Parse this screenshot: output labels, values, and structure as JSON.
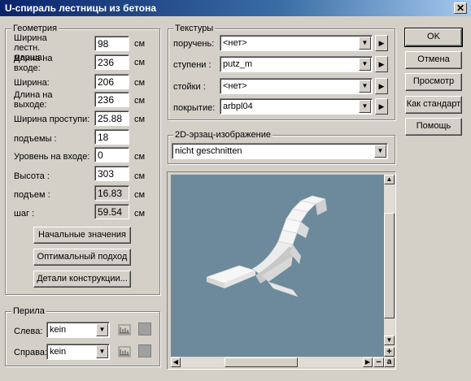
{
  "window": {
    "title": "U-спираль лестницы из бетона",
    "close": "✕"
  },
  "geometry": {
    "legend": "Геометрия",
    "fields": [
      {
        "label": "Ширина лестн. марша:",
        "value": "98",
        "unit": "см"
      },
      {
        "label": "Длина на входе:",
        "value": "236",
        "unit": "см"
      },
      {
        "label": "Ширина:",
        "value": "206",
        "unit": "см"
      },
      {
        "label": "Длина на выходе:",
        "value": "236",
        "unit": "см"
      },
      {
        "label": "Ширина проступи:",
        "value": "25.88",
        "unit": "см"
      },
      {
        "label": "подъемы :",
        "value": "18"
      },
      {
        "label": "Уровень на входе:",
        "value": "0",
        "unit": "см"
      },
      {
        "label": "Высота :",
        "value": "303",
        "unit": "см"
      },
      {
        "label": "подъем :",
        "value": "16.83",
        "unit": "см"
      },
      {
        "label": "шаг :",
        "value": "59.54",
        "unit": "см"
      }
    ],
    "buttons": {
      "initial": "Начальные значения",
      "optimal": "Оптимальный подход",
      "details": "Детали конструкции..."
    }
  },
  "railing": {
    "legend": "Перила",
    "left": {
      "label": "Слева:",
      "value": "kein"
    },
    "right": {
      "label": "Справа:",
      "value": "kein"
    }
  },
  "textures": {
    "legend": "Текстуры",
    "rows": [
      {
        "label": "поручень:",
        "value": "<нет>"
      },
      {
        "label": "ступени :",
        "value": "putz_m"
      },
      {
        "label": "стойки :",
        "value": "<нет>"
      },
      {
        "label": "покрытие:",
        "value": "arbpl04"
      }
    ]
  },
  "image2d": {
    "legend": "2D-эрзац-изображение",
    "value": "nicht geschnitten"
  },
  "actions": {
    "ok": "OK",
    "cancel": "Отмена",
    "preview": "Просмотр",
    "standard": "Как стандарт",
    "help": "Помощь"
  },
  "preview": {
    "zoom_in": "+",
    "zoom_out": "−",
    "zoom_auto": "a",
    "background": "#6c8a9c"
  },
  "icons": {
    "dropdown": "▼",
    "arrow_right": "▶",
    "scroll_up": "▲",
    "scroll_down": "▼",
    "scroll_left": "◀",
    "scroll_right": "▶"
  }
}
